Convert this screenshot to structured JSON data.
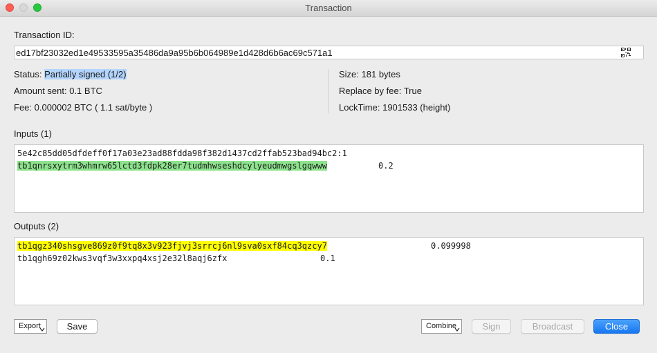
{
  "window": {
    "title": "Transaction"
  },
  "txid": {
    "label": "Transaction ID:",
    "value": "ed17bf23032ed1e49533595a35486da9a95b6b064989e1d428d6b6ac69c571a1"
  },
  "details": {
    "status_label": "Status: ",
    "status_value": "Partially signed (1/2)",
    "amount_sent": "Amount sent: 0.1 BTC",
    "fee": "Fee: 0.000002 BTC  ( 1.1 sat/byte )",
    "size": "Size: 181 bytes",
    "replace_by_fee": "Replace by fee: True",
    "locktime": "LockTime: 1901533 (height)"
  },
  "inputs": {
    "label": "Inputs (1)",
    "prevout": "5e42c85dd05dfdeff0f17a03e23ad88fdda98f382d1437cd2ffab523bad94bc2:1",
    "address": "tb1qnrsxytrm3whmrw65lctd3fdpk28er7tudmhwseshdcylyeudmwgslgqwww",
    "amount": "0.2"
  },
  "outputs": {
    "label": "Outputs (2)",
    "items": [
      {
        "address": "tb1qgz340shsgve869z0f9tq8x3v923fjvj3srrcj6nl9sva0sxf84cq3qzcy7",
        "amount": "0.099998"
      },
      {
        "address": "tb1qgh69z02kws3vqf3w3xxpq4xsj2e32l8aqj6zfx",
        "amount": "0.1"
      }
    ]
  },
  "buttons": {
    "export": "Export",
    "save": "Save",
    "combine": "Combine",
    "sign": "Sign",
    "broadcast": "Broadcast",
    "close": "Close"
  },
  "colors": {
    "input_highlight": "#8de38d",
    "change_highlight": "#ffff00",
    "status_highlight": "#b3d4fc",
    "primary_button": "#1877f2"
  },
  "icons": {
    "qr": "qrcode-icon"
  }
}
